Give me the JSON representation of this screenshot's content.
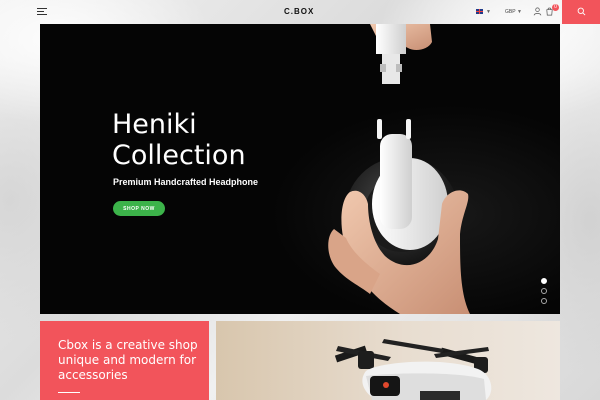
{
  "header": {
    "logo": "C.BOX",
    "currency": "GBP",
    "cart_count": "0"
  },
  "hero": {
    "title_line1": "Heniki",
    "title_line2": "Collection",
    "subtitle": "Premium Handcrafted Headphone",
    "cta": "SHOP NOW",
    "slides_total": 3,
    "active_slide": 1
  },
  "promo": {
    "text": "Cbox is a creative shop unique and modern for accessories"
  },
  "colors": {
    "accent": "#f2545b",
    "cta": "#3cb34a",
    "hero_bg": "#050505"
  },
  "icons": [
    "menu-icon",
    "flag-icon",
    "user-icon",
    "cart-icon",
    "search-icon"
  ]
}
